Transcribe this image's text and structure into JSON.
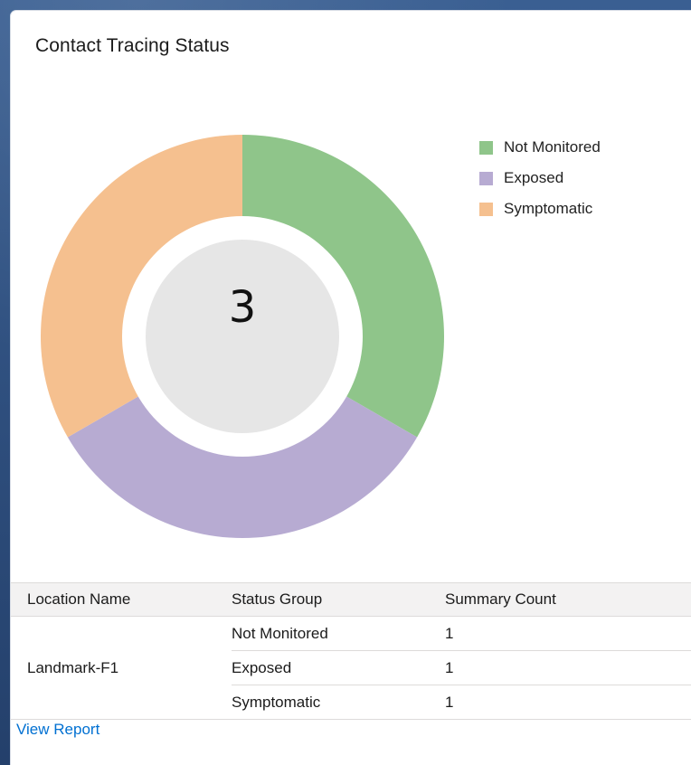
{
  "card": {
    "title": "Contact Tracing Status"
  },
  "chart_data": {
    "type": "pie",
    "variant": "donut",
    "center_label": "3",
    "slices": [
      {
        "label": "Not Monitored",
        "value": 1,
        "color": "#8fc58a"
      },
      {
        "label": "Exposed",
        "value": 1,
        "color": "#b7abd2"
      },
      {
        "label": "Symptomatic",
        "value": 1,
        "color": "#f5c08f"
      }
    ],
    "legend_position": "top-right"
  },
  "table": {
    "headers": [
      "Location Name",
      "Status Group",
      "Summary Count"
    ],
    "location": "Landmark-F1",
    "rows": [
      {
        "status": "Not Monitored",
        "count": "1"
      },
      {
        "status": "Exposed",
        "count": "1"
      },
      {
        "status": "Symptomatic",
        "count": "1"
      }
    ]
  },
  "footer": {
    "view_report_label": "View Report"
  },
  "colors": {
    "link": "#0070d2",
    "header_bg": "#f3f2f2",
    "center_disc": "#e6e6e6"
  }
}
